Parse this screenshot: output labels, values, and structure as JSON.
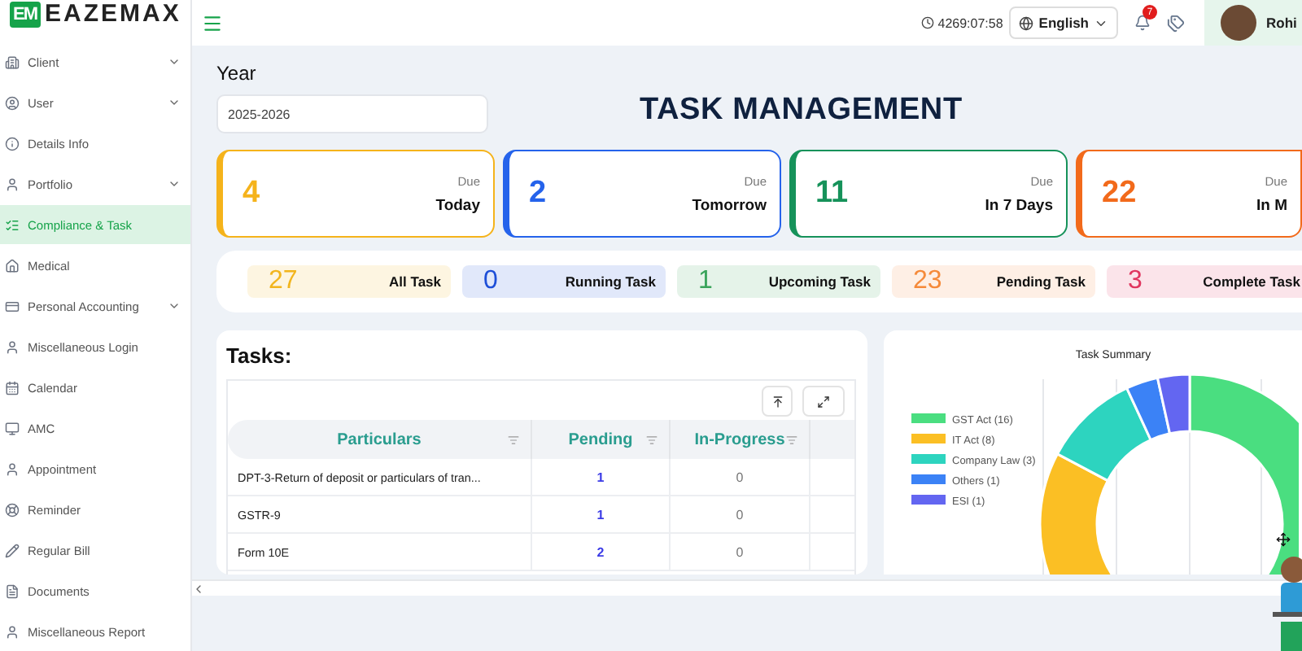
{
  "brand": {
    "mark": "EM",
    "name": "EAZEMAX"
  },
  "sidebar": {
    "items": [
      {
        "label": "Client",
        "has_submenu": true,
        "selected": false
      },
      {
        "label": "User",
        "has_submenu": true,
        "selected": false
      },
      {
        "label": "Details Info",
        "has_submenu": false,
        "selected": false
      },
      {
        "label": "Portfolio",
        "has_submenu": true,
        "selected": false
      },
      {
        "label": "Compliance & Task",
        "has_submenu": false,
        "selected": true
      },
      {
        "label": "Medical",
        "has_submenu": false,
        "selected": false
      },
      {
        "label": "Personal Accounting",
        "has_submenu": true,
        "selected": false
      },
      {
        "label": "Miscellaneous Login",
        "has_submenu": false,
        "selected": false
      },
      {
        "label": "Calendar",
        "has_submenu": false,
        "selected": false
      },
      {
        "label": "AMC",
        "has_submenu": false,
        "selected": false
      },
      {
        "label": "Appointment",
        "has_submenu": false,
        "selected": false
      },
      {
        "label": "Reminder",
        "has_submenu": false,
        "selected": false
      },
      {
        "label": "Regular Bill",
        "has_submenu": false,
        "selected": false
      },
      {
        "label": "Documents",
        "has_submenu": false,
        "selected": false
      },
      {
        "label": "Miscellaneous Report",
        "has_submenu": false,
        "selected": false
      }
    ]
  },
  "topbar": {
    "timer": "4269:07:58",
    "language": "English",
    "notification_count": "7",
    "user_name": "Rohi"
  },
  "year": {
    "label": "Year",
    "value": "2025-2026"
  },
  "page_title": "TASK MANAGEMENT",
  "due_cards": [
    {
      "count": "4",
      "caption": "Due",
      "period": "Today",
      "color": "#f5b31b"
    },
    {
      "count": "2",
      "caption": "Due",
      "period": "Tomorrow",
      "color": "#2563eb"
    },
    {
      "count": "11",
      "caption": "Due",
      "period": "In 7 Days",
      "color": "#16925a"
    },
    {
      "count": "22",
      "caption": "Due",
      "period": "In M",
      "color": "#f26a1b"
    }
  ],
  "status_chips": [
    {
      "count": "27",
      "label": "All Task",
      "color": "#f2b51d"
    },
    {
      "count": "0",
      "label": "Running Task",
      "color": "#1e4fd8"
    },
    {
      "count": "1",
      "label": "Upcoming Task",
      "color": "#3aa45b"
    },
    {
      "count": "23",
      "label": "Pending Task",
      "color": "#f58a3a"
    },
    {
      "count": "3",
      "label": "Complete Task",
      "color": "#e0365f"
    }
  ],
  "tasks": {
    "title": "Tasks:",
    "columns": [
      "Particulars",
      "Pending",
      "In-Progress"
    ],
    "rows": [
      {
        "particulars": "DPT-3-Return of deposit or particulars of tran...",
        "pending": "1",
        "in_progress": "0"
      },
      {
        "particulars": "GSTR-9",
        "pending": "1",
        "in_progress": "0"
      },
      {
        "particulars": "Form 10E",
        "pending": "2",
        "in_progress": "0"
      }
    ]
  },
  "summary": {
    "chart_data": {
      "type": "donut",
      "title": "Task Summary",
      "categories": [
        "GST Act (16)",
        "IT Act (8)",
        "Company Law (3)",
        "Others (1)",
        "ESI (1)"
      ],
      "values": [
        16,
        8,
        3,
        1,
        1
      ],
      "legend": "left",
      "colors": [
        "#4ade80",
        "#fbbf24",
        "#2dd4bf",
        "#3b82f6",
        "#6366f1"
      ]
    }
  }
}
